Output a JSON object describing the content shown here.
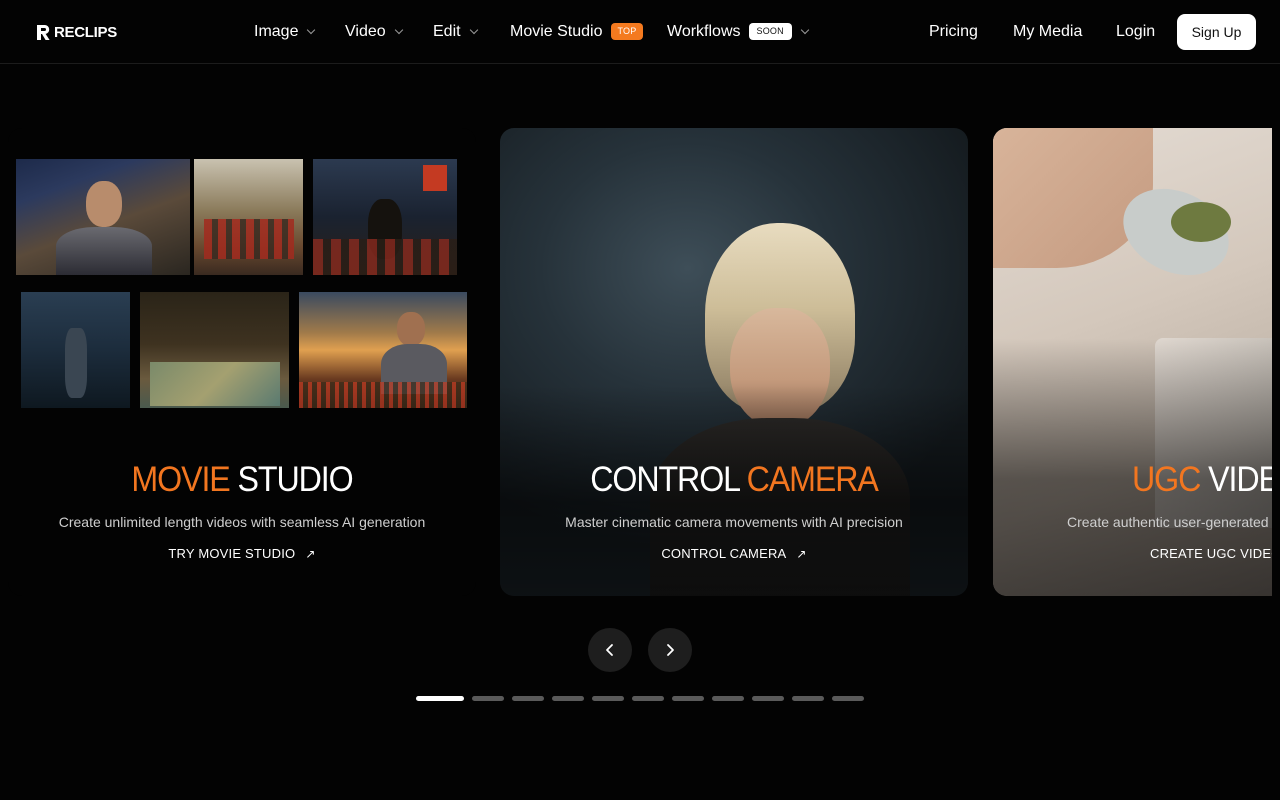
{
  "brand": {
    "name": "RECLIPS"
  },
  "nav": {
    "image": "Image",
    "video": "Video",
    "edit": "Edit",
    "movie_studio": "Movie Studio",
    "movie_studio_badge": "TOP",
    "workflows": "Workflows",
    "workflows_badge": "SOON",
    "pricing": "Pricing",
    "my_media": "My Media",
    "login": "Login",
    "signup": "Sign Up"
  },
  "slides": [
    {
      "title_accent": "MOVIE",
      "title_rest": "STUDIO",
      "description": "Create unlimited length videos with seamless AI generation",
      "cta": "TRY MOVIE STUDIO"
    },
    {
      "title_rest": "CONTROL",
      "title_accent": "CAMERA",
      "description": "Master cinematic camera movements with AI precision",
      "cta": "CONTROL CAMERA"
    },
    {
      "title_accent": "UGC",
      "title_rest": "VIDEOS",
      "description": "Create authentic user-generated style videos",
      "cta": "CREATE UGC VIDEOS"
    }
  ],
  "carousel": {
    "total": 11,
    "active_index": 0
  },
  "icons": {
    "prev": "chevron-left-icon",
    "next": "chevron-right-icon",
    "cta": "arrow-up-right-icon"
  },
  "colors": {
    "accent": "#f27620",
    "background": "#030303",
    "badge_top": "#f47a1f"
  }
}
